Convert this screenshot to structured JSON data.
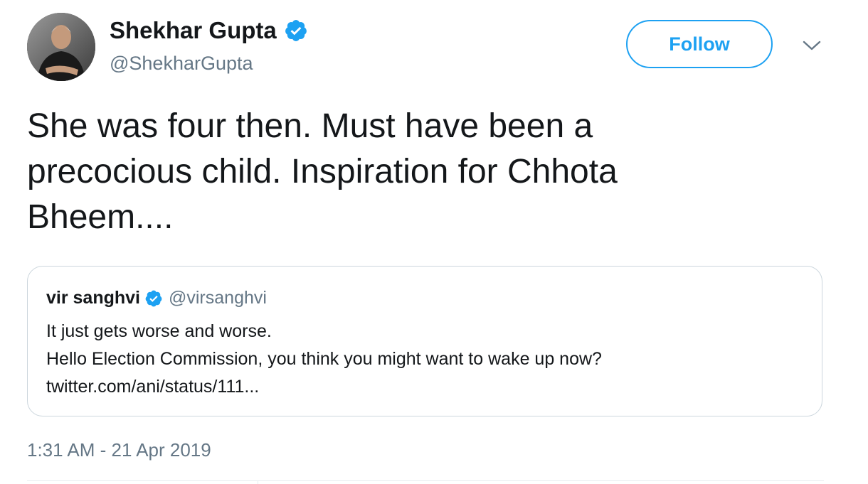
{
  "author": {
    "display_name": "Shekhar Gupta",
    "handle": "@ShekharGupta",
    "verified": true,
    "avatar_icon": "profile-photo"
  },
  "actions": {
    "follow_label": "Follow",
    "more_icon": "chevron-down-icon"
  },
  "tweet": {
    "text": "She was four then. Must have been a\nprecocious child. Inspiration for Chhota\nBheem....",
    "timestamp": "1:31 AM - 21 Apr 2019"
  },
  "quoted_tweet": {
    "display_name": "vir sanghvi",
    "handle": "@virsanghvi",
    "verified": true,
    "lines": [
      "It just gets worse and worse.",
      "Hello Election Commission, you think you might want to wake up now?",
      "twitter.com/ani/status/111..."
    ]
  },
  "colors": {
    "accent": "#1da1f2",
    "secondary_text": "#657786",
    "border": "#ccd6dd"
  }
}
